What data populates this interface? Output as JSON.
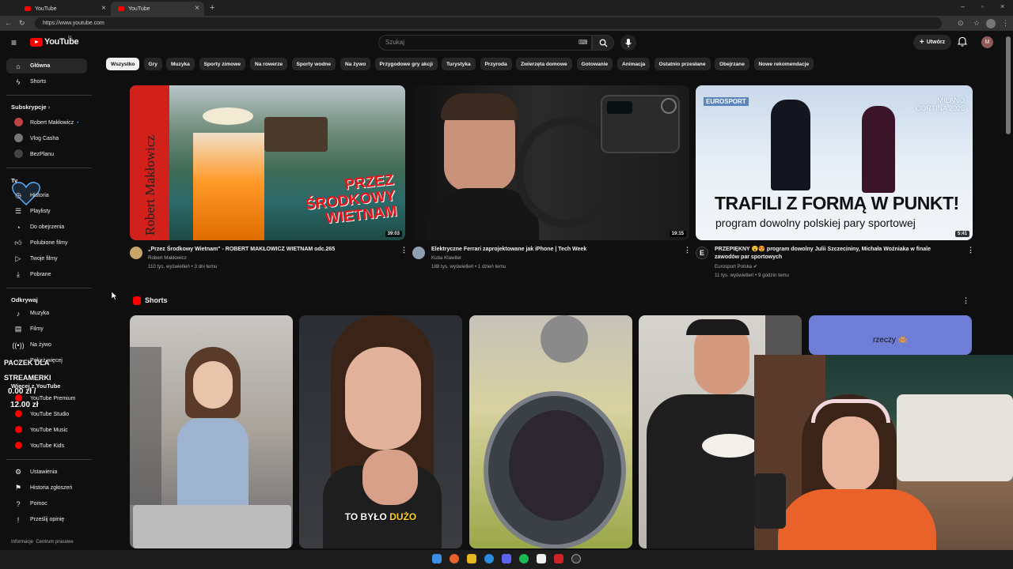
{
  "browser": {
    "tabs": [
      {
        "title": "YouTube"
      },
      {
        "title": "YouTube"
      }
    ],
    "url": "https://www.youtube.com"
  },
  "header": {
    "logo_text": "YouTube",
    "country_code": "PL",
    "search_placeholder": "Szukaj",
    "create_label": "Utwórz",
    "avatar_letter": "M"
  },
  "sidebar": {
    "main": [
      {
        "label": "Główna",
        "icon": "home-icon"
      },
      {
        "label": "Shorts",
        "icon": "shorts-icon"
      }
    ],
    "subscriptions_title": "Subskrypcje",
    "subscriptions": [
      {
        "label": "Robert Makłowicz"
      },
      {
        "label": "Vlog Casha"
      },
      {
        "label": "BezPlanu"
      }
    ],
    "you_title": "Ty",
    "you": [
      {
        "label": "Historia"
      },
      {
        "label": "Playlisty"
      },
      {
        "label": "Do obejrzenia"
      },
      {
        "label": "Polubione filmy"
      },
      {
        "label": "Twoje filmy"
      },
      {
        "label": "Pobrane"
      }
    ],
    "explore_title": "Odkrywaj",
    "explore": [
      {
        "label": "Muzyka"
      },
      {
        "label": "Filmy"
      },
      {
        "label": "Na żywo"
      },
      {
        "label": "Pokaż więcej"
      }
    ],
    "more_title": "Więcej z YouTube",
    "more": [
      {
        "label": "YouTube Premium"
      },
      {
        "label": "YouTube Studio"
      },
      {
        "label": "YouTube Music"
      },
      {
        "label": "YouTube Kids"
      }
    ],
    "settings": [
      {
        "label": "Ustawienia"
      },
      {
        "label": "Historia zgłoszeń"
      },
      {
        "label": "Pomoc"
      },
      {
        "label": "Prześlij opinię"
      }
    ],
    "footer": "Informacje  Centrum prasowe"
  },
  "overlay": {
    "line1": "PACZEK DLA",
    "line2": "STREAMERKI",
    "amount1": "0.00 zł /",
    "amount2": "12.00 zł"
  },
  "chips": [
    "Wszystko",
    "Gry",
    "Muzyka",
    "Sporty zimowe",
    "Na rowerze",
    "Sporty wodne",
    "Na żywo",
    "Przygodowe gry akcji",
    "Turystyka",
    "Przyroda",
    "Zwierzęta domowe",
    "Gotowanie",
    "Animacja",
    "Ostatnio przesłane",
    "Obejrzane",
    "Nowe rekomendacje"
  ],
  "videos": [
    {
      "title": "„Przez Środkowy Wietnam\" - ROBERT MAKŁOWICZ WIETNAM odc.265",
      "channel": "Robert Makłowicz",
      "meta": "110 tys. wyświetleń • 3 dni temu",
      "duration": "39:03",
      "thumb_text_side": "Robert Makłowicz",
      "thumb_text_main": "PRZEZ ŚRODKOWY WIETNAM"
    },
    {
      "title": "Elektryczne Ferrari zaprojektowane jak iPhone | Tech Week",
      "channel": "Kuba Klawiter",
      "meta": "188 tys. wyświetleń • 1 dzień temu",
      "duration": "19:15"
    },
    {
      "title_line1": "PRZEPIĘKNY 😮😍 program dowolny Julii Szczecininy, Michała Woźniaka w finale",
      "title_line2": "zawodów par sportowych",
      "channel": "Eurosport Polska",
      "meta": "11 tys. wyświetleń • 9 godzin temu",
      "duration": "5:41",
      "thumb_brand": "EUROSPORT",
      "thumb_event": "MILANO CORTINA 2026",
      "thumb_headline": "TRAFILI Z FORMĄ W PUNKT!",
      "thumb_sub": "program dowolny polskiej pary sportowej"
    }
  ],
  "shorts": {
    "title": "Shorts",
    "caption2": "TO BYŁO",
    "caption2_hl": "DUŻO",
    "caption5": "rzeczy 🙈"
  },
  "colors": {
    "accent": "#ff0000",
    "chip_active": "#f1f1f1",
    "bg": "#0f0f0f"
  }
}
